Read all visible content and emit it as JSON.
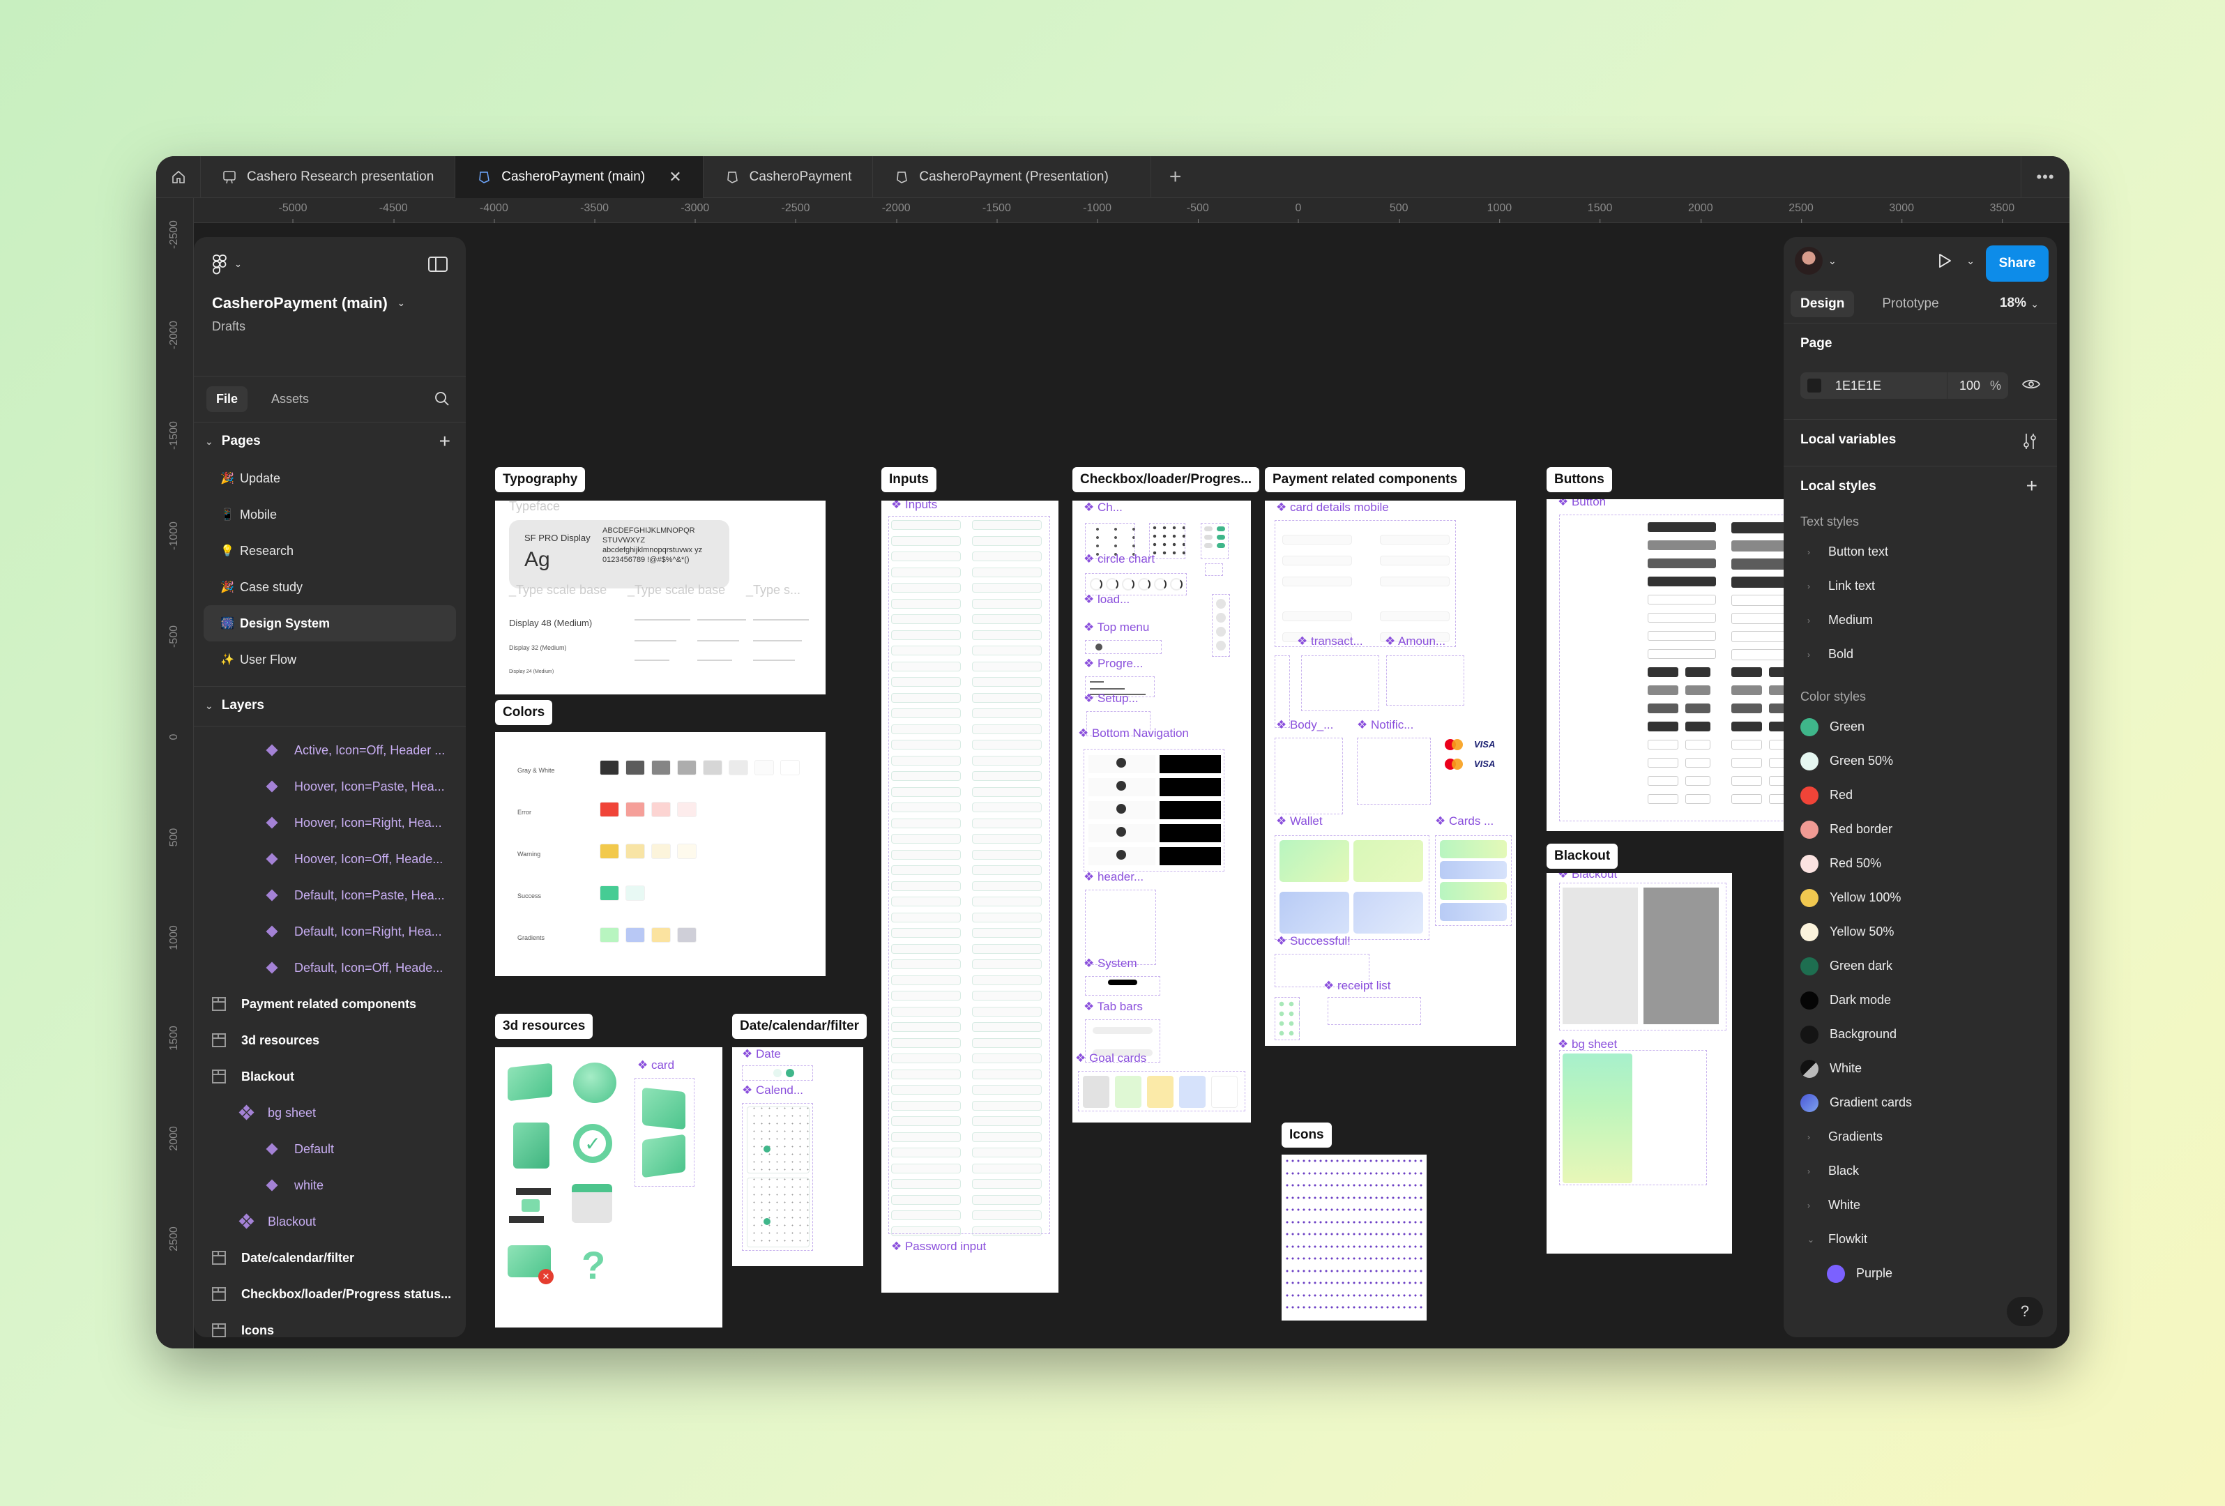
{
  "tabs": [
    {
      "label": "Cashero Research presentation",
      "icon": "presentation-icon",
      "active": false
    },
    {
      "label": "CasheroPayment (main)",
      "icon": "figma-file-icon",
      "active": true
    },
    {
      "label": "CasheroPayment",
      "icon": "figma-file-icon",
      "active": false
    },
    {
      "label": "CasheroPayment (Presentation)",
      "icon": "figma-file-icon",
      "active": false
    }
  ],
  "tab_close": "✕",
  "tab_add": "+",
  "tab_more": "•••",
  "ruler": {
    "horizontal": [
      "-5000",
      "-4500",
      "-4000",
      "-3500",
      "-3000",
      "-2500",
      "-2000",
      "-1500",
      "-1000",
      "-500",
      "0",
      "500",
      "1000",
      "1500",
      "2000",
      "2500",
      "3000",
      "3500"
    ],
    "vertical": [
      "-2500",
      "-2000",
      "-1500",
      "-1000",
      "-500",
      "0",
      "500",
      "1000",
      "1500",
      "2000",
      "2500"
    ]
  },
  "left_panel": {
    "file_title": "CasheroPayment (main)",
    "file_location": "Drafts",
    "tabs": {
      "file": "File",
      "assets": "Assets"
    },
    "pages_heading": "Pages",
    "pages": [
      {
        "emoji": "🎉",
        "label": "Update",
        "active": false
      },
      {
        "emoji": "📱",
        "label": "Mobile",
        "active": false
      },
      {
        "emoji": "💡",
        "label": "Research",
        "active": false
      },
      {
        "emoji": "🎉",
        "label": "Case study",
        "active": false
      },
      {
        "emoji": "🎆",
        "label": "Design System",
        "active": true
      },
      {
        "emoji": "✨",
        "label": "User Flow",
        "active": false
      }
    ],
    "layers_heading": "Layers",
    "layers": [
      {
        "label": "Active, Icon=Off, Header ...",
        "type": "variant",
        "level": 3
      },
      {
        "label": "Hoover, Icon=Paste, Hea...",
        "type": "variant",
        "level": 3
      },
      {
        "label": "Hoover, Icon=Right, Hea...",
        "type": "variant",
        "level": 3
      },
      {
        "label": "Hoover, Icon=Off, Heade...",
        "type": "variant",
        "level": 3
      },
      {
        "label": "Default, Icon=Paste, Hea...",
        "type": "variant",
        "level": 3
      },
      {
        "label": "Default, Icon=Right, Hea...",
        "type": "variant",
        "level": 3
      },
      {
        "label": "Default, Icon=Off, Heade...",
        "type": "variant",
        "level": 3
      },
      {
        "label": "Payment related components",
        "type": "frame",
        "level": 1
      },
      {
        "label": "3d resources",
        "type": "frame",
        "level": 1
      },
      {
        "label": "Blackout",
        "type": "frame",
        "level": 1
      },
      {
        "label": "bg sheet",
        "type": "component-set",
        "level": 2
      },
      {
        "label": "Default",
        "type": "variant",
        "level": 3
      },
      {
        "label": "white",
        "type": "variant",
        "level": 3
      },
      {
        "label": "Blackout",
        "type": "component-set",
        "level": 2
      },
      {
        "label": "Date/calendar/filter",
        "type": "frame",
        "level": 1
      },
      {
        "label": "Checkbox/loader/Progress status...",
        "type": "frame",
        "level": 1
      },
      {
        "label": "Icons",
        "type": "frame",
        "level": 1
      }
    ]
  },
  "right_panel": {
    "share_label": "Share",
    "tabs": {
      "design": "Design",
      "prototype": "Prototype"
    },
    "zoom_level": "18%",
    "page_heading": "Page",
    "page_color_hex": "1E1E1E",
    "page_color_opacity": "100",
    "percent": "%",
    "local_variables": "Local variables",
    "local_styles": "Local styles",
    "text_styles_heading": "Text styles",
    "text_styles": [
      "Button text",
      "Link text",
      "Medium",
      "Bold"
    ],
    "color_styles_heading": "Color styles",
    "color_styles": [
      {
        "label": "Green",
        "color": "#3fb68a"
      },
      {
        "label": "Green 50%",
        "color": "#e6f7f1"
      },
      {
        "label": "Red",
        "color": "#f04438"
      },
      {
        "label": "Red border",
        "color": "#f09b94"
      },
      {
        "label": "Red 50%",
        "color": "#fbe3e1"
      },
      {
        "label": "Yellow 100%",
        "color": "#f0c850"
      },
      {
        "label": "Yellow 50%",
        "color": "#fbf3dc"
      },
      {
        "label": "Green dark",
        "color": "#1e6e50"
      },
      {
        "label": "Dark mode",
        "color": "#050505"
      },
      {
        "label": "Background",
        "color": "#141414"
      },
      {
        "label": "White",
        "color": "#888888"
      },
      {
        "label": "Gradient cards",
        "color": "#5a6ee0"
      }
    ],
    "color_groups": [
      {
        "label": "Gradients",
        "expanded": false
      },
      {
        "label": "Black",
        "expanded": false
      },
      {
        "label": "White",
        "expanded": false
      },
      {
        "label": "Flowkit",
        "expanded": true
      }
    ],
    "flowkit_children": [
      {
        "label": "Purple",
        "color": "#7b61ff"
      }
    ],
    "help": "?"
  },
  "canvas": {
    "frames": {
      "typography": "Typography",
      "colors": "Colors",
      "resources3d": "3d resources",
      "date": "Date/calendar/filter",
      "inputs": "Inputs",
      "checkbox": "Checkbox/loader/Progres...",
      "payment": "Payment related components",
      "icons": "Icons",
      "buttons": "Buttons",
      "blackout": "Blackout"
    },
    "typography": {
      "typeface": "Typeface",
      "font_name": "SF PRO Display",
      "sample": "Ag",
      "upper": "ABCDEFGHIJKLMNOPQR STUVWXYZ",
      "lower": "abcdefghijklmnopqrstuvwx yz",
      "digits": "0123456789 !@#$%^&*()",
      "scale_heads": [
        "_Type scale base",
        "_Type scale base",
        "_Type s..."
      ],
      "display_rows": [
        "Display 48 (Medium)",
        "Display 32 (Medium)",
        "Display 24 (Medium)"
      ]
    },
    "colors": {
      "groups": [
        {
          "label": "Gray & White",
          "swatches": [
            "#333333",
            "#5c5c5c",
            "#858585",
            "#adadad",
            "#d6d6d6",
            "#ebebeb",
            "#fbfbfb",
            "#ffffff"
          ]
        },
        {
          "label": "Error",
          "swatches": [
            "#f04438",
            "#f59f99",
            "#fcd4d2",
            "#fdecec"
          ]
        },
        {
          "label": "Warning",
          "swatches": [
            "#f2c94c",
            "#f8e4a5",
            "#fcf4db",
            "#fefaed"
          ]
        },
        {
          "label": "Success",
          "swatches": [
            "#46cc94",
            "#e8f9f4"
          ]
        },
        {
          "label": "Gradients",
          "swatches": [
            "#b8f5c0",
            "#b8c8f5",
            "#fbe3a0",
            "#cfcfd8"
          ]
        }
      ]
    },
    "components": {
      "inputs": "Inputs",
      "password_input": "Password input",
      "checkbox": "Ch...",
      "circle_chart": "circle chart",
      "loader": "load...",
      "top_menu": "Top menu",
      "progress": "Progre...",
      "setup": "Setup...",
      "bottom_navigation": "Bottom Navigation",
      "header": "header...",
      "system": "System",
      "tab_bars": "Tab bars",
      "goal_cards": "Goal cards",
      "card_details_mobile": "card details mobile",
      "transactions": "transact...",
      "amount": "Amoun...",
      "body": "Body_...",
      "notifications": "Notific...",
      "wallet": "Wallet",
      "cards": "Cards ...",
      "successful": "Successful!",
      "receipt_list": "receipt list",
      "button": "Button",
      "blackout": "Blackout",
      "bg_sheet": "bg sheet",
      "card": "card",
      "date": "Date",
      "calendar": "Calend..."
    },
    "visa": "VISA"
  },
  "toolbar": {
    "tools": [
      "move",
      "frame",
      "rectangle",
      "pen",
      "text",
      "comment",
      "actions"
    ],
    "active_tool": "move",
    "dev_mode": "</>"
  }
}
